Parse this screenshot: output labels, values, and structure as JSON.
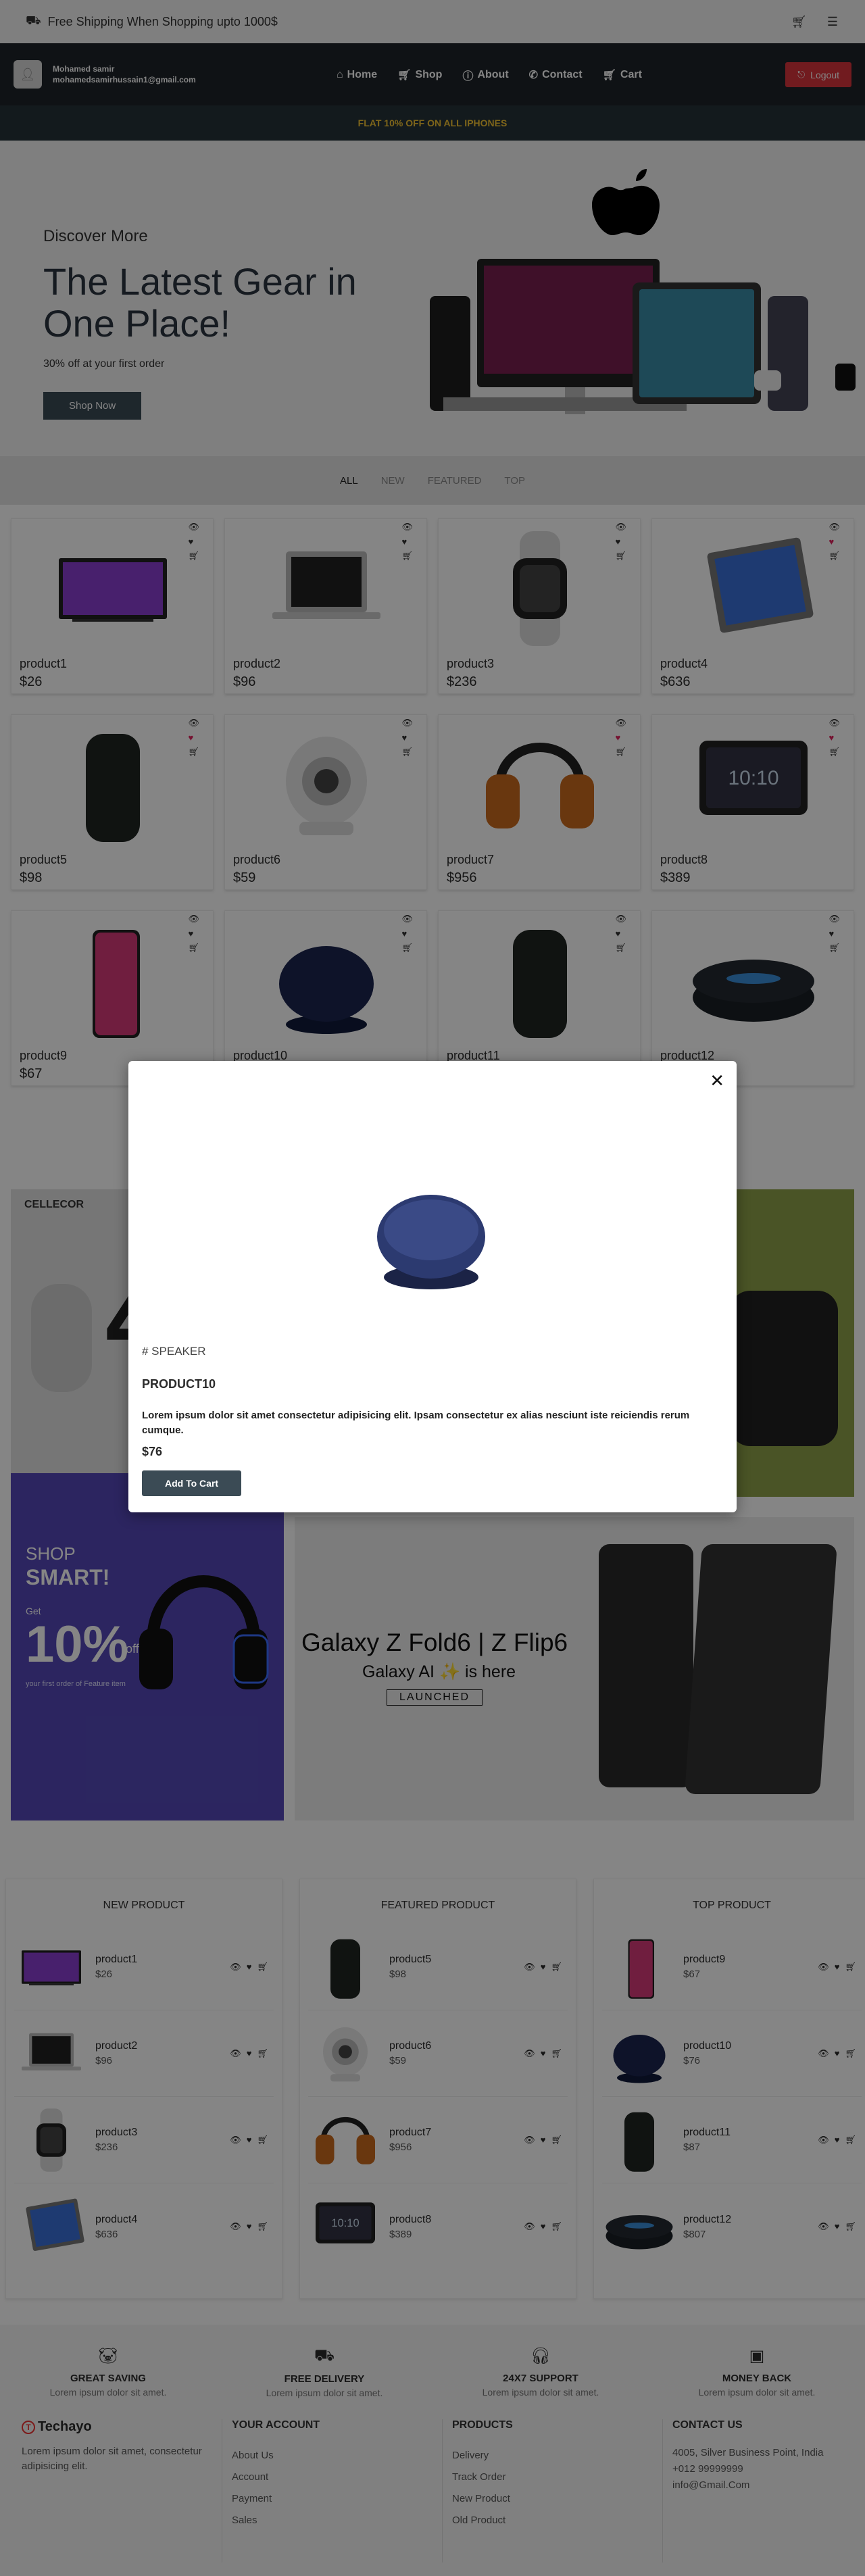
{
  "topbar": {
    "shipping_text": "Free Shipping When Shopping upto 1000$"
  },
  "navbar": {
    "user_name": "Mohamed samir",
    "user_email": "mohamedsamirhussain1@gmail.com",
    "links": [
      "Home",
      "Shop",
      "About",
      "Contact",
      "Cart"
    ],
    "logout_label": "Logout"
  },
  "promo": {
    "text": "FLAT 10% OFF ON ALL IPHONES"
  },
  "hero": {
    "eyebrow": "Discover More",
    "headline": "The Latest Gear in One Place!",
    "offer": "30% off at your first order",
    "cta": "Shop Now"
  },
  "filters": {
    "items": [
      "ALL",
      "NEW",
      "FEATURED",
      "TOP"
    ],
    "active": "ALL"
  },
  "products": [
    {
      "name": "product1",
      "price": "$26",
      "icon": "tv-icon",
      "liked": false
    },
    {
      "name": "product2",
      "price": "$96",
      "icon": "laptop-icon",
      "liked": false
    },
    {
      "name": "product3",
      "price": "$236",
      "icon": "watch-icon",
      "liked": false
    },
    {
      "name": "product4",
      "price": "$636",
      "icon": "tablet-icon",
      "liked": true
    },
    {
      "name": "product5",
      "price": "$98",
      "icon": "smart-speaker-icon",
      "liked": true
    },
    {
      "name": "product6",
      "price": "$59",
      "icon": "camera-icon",
      "liked": false
    },
    {
      "name": "product7",
      "price": "$956",
      "icon": "headset-icon",
      "liked": true
    },
    {
      "name": "product8",
      "price": "$389",
      "icon": "smart-display-icon",
      "liked": true
    },
    {
      "name": "product9",
      "price": "$67",
      "icon": "phone-icon",
      "liked": false
    },
    {
      "name": "product10",
      "price": "",
      "icon": "charger-icon",
      "liked": false
    },
    {
      "name": "product11",
      "price": "",
      "icon": "smart-speaker-icon",
      "liked": false
    },
    {
      "name": "product12",
      "price": "",
      "icon": "echo-dot-icon",
      "liked": false
    }
  ],
  "banners": {
    "cellecor_brand": "CELLECOR",
    "shop_smart_1": "SHOP",
    "shop_smart_2": "SMART!",
    "get_label": "Get",
    "discount": "10%",
    "discount_suffix": "off",
    "discount_sub": "your first order of Feature item",
    "galaxy_title": "Galaxy Z Fold6 | Z Flip6",
    "galaxy_sub": "Galaxy AI ✨ is here",
    "launched": "LAUNCHED"
  },
  "lists": [
    {
      "title": "NEW PRODUCT",
      "items": [
        {
          "name": "product1",
          "price": "$26"
        },
        {
          "name": "product2",
          "price": "$96"
        },
        {
          "name": "product3",
          "price": "$236"
        },
        {
          "name": "product4",
          "price": "$636"
        }
      ]
    },
    {
      "title": "FEATURED PRODUCT",
      "items": [
        {
          "name": "product5",
          "price": "$98"
        },
        {
          "name": "product6",
          "price": "$59"
        },
        {
          "name": "product7",
          "price": "$956"
        },
        {
          "name": "product8",
          "price": "$389"
        }
      ]
    },
    {
      "title": "TOP PRODUCT",
      "items": [
        {
          "name": "product9",
          "price": "$67"
        },
        {
          "name": "product10",
          "price": "$76"
        },
        {
          "name": "product11",
          "price": "$87"
        },
        {
          "name": "product12",
          "price": "$807"
        }
      ]
    }
  ],
  "features": [
    {
      "title": "GREAT SAVING",
      "desc": "Lorem ipsum dolor sit amet."
    },
    {
      "title": "FREE DELIVERY",
      "desc": "Lorem ipsum dolor sit amet."
    },
    {
      "title": "24X7 SUPPORT",
      "desc": "Lorem ipsum dolor sit amet."
    },
    {
      "title": "MONEY BACK",
      "desc": "Lorem ipsum dolor sit amet."
    }
  ],
  "footer": {
    "brand": "Techayo",
    "about": "Lorem ipsum dolor sit amet, consectetur adipisicing elit.",
    "account_title": "YOUR ACCOUNT",
    "account_links": [
      "About Us",
      "Account",
      "Payment",
      "Sales"
    ],
    "products_title": "PRODUCTS",
    "products_links": [
      "Delivery",
      "Track Order",
      "New Product",
      "Old Product"
    ],
    "contact_title": "CONTACT US",
    "contact_lines": [
      "4005, Silver Business Point, India",
      "+012 99999999",
      "info@Gmail.Com"
    ]
  },
  "modal": {
    "category": "# SPEAKER",
    "title": "PRODUCT10",
    "description": "Lorem ipsum dolor sit amet consectetur adipisicing elit. Ipsam consectetur ex alias nesciunt iste reiciendis rerum cumque.",
    "price": "$76",
    "add_label": "Add To Cart"
  },
  "colors": {
    "navbar": "#1e2429",
    "promo_text": "#f1c232",
    "button": "#3b4b55",
    "logout": "#d9343c",
    "liked": "#e0245e"
  }
}
